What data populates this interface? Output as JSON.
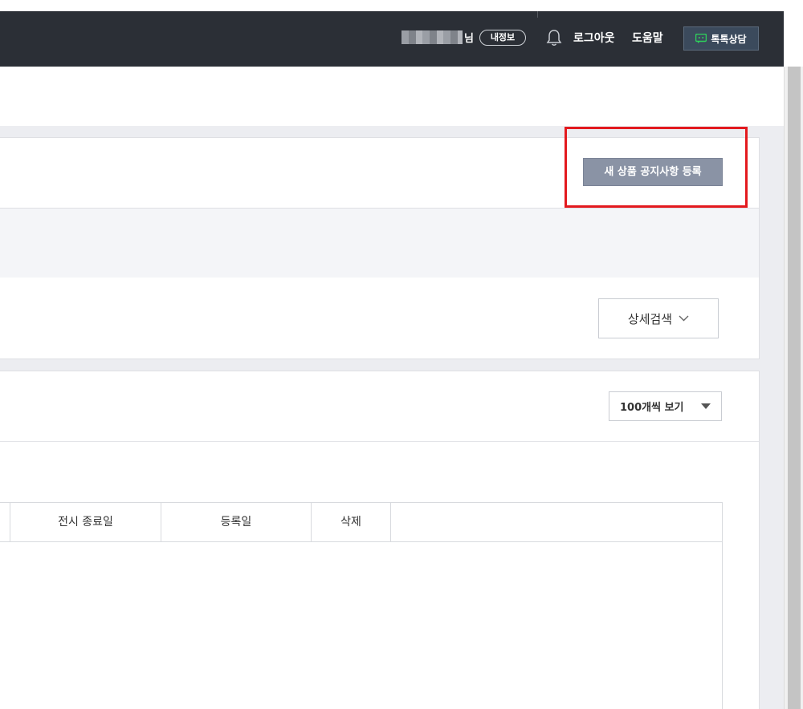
{
  "topbar": {
    "user_suffix": "님",
    "my_info_label": "내정보",
    "logout_label": "로그아웃",
    "help_label": "도움말",
    "talk_label": "톡톡상담"
  },
  "notice_panel": {
    "new_notice_button": "새 상품 공지사항 등록"
  },
  "search_panel": {
    "detail_search_label": "상세검색"
  },
  "list_panel": {
    "page_size_selected": "100개씩 보기"
  },
  "table": {
    "columns": [
      "",
      "전시 종료일",
      "등록일",
      "삭제"
    ]
  },
  "colors": {
    "topbar": "#2b2f36",
    "primary_button": "#8a93a5",
    "highlight": "#e3191e",
    "talk_icon": "#2ed15b"
  },
  "icons": [
    "bell-icon",
    "talk-chat-icon",
    "chevron-down-icon",
    "caret-down-icon",
    "annotation-arrow-icon"
  ]
}
